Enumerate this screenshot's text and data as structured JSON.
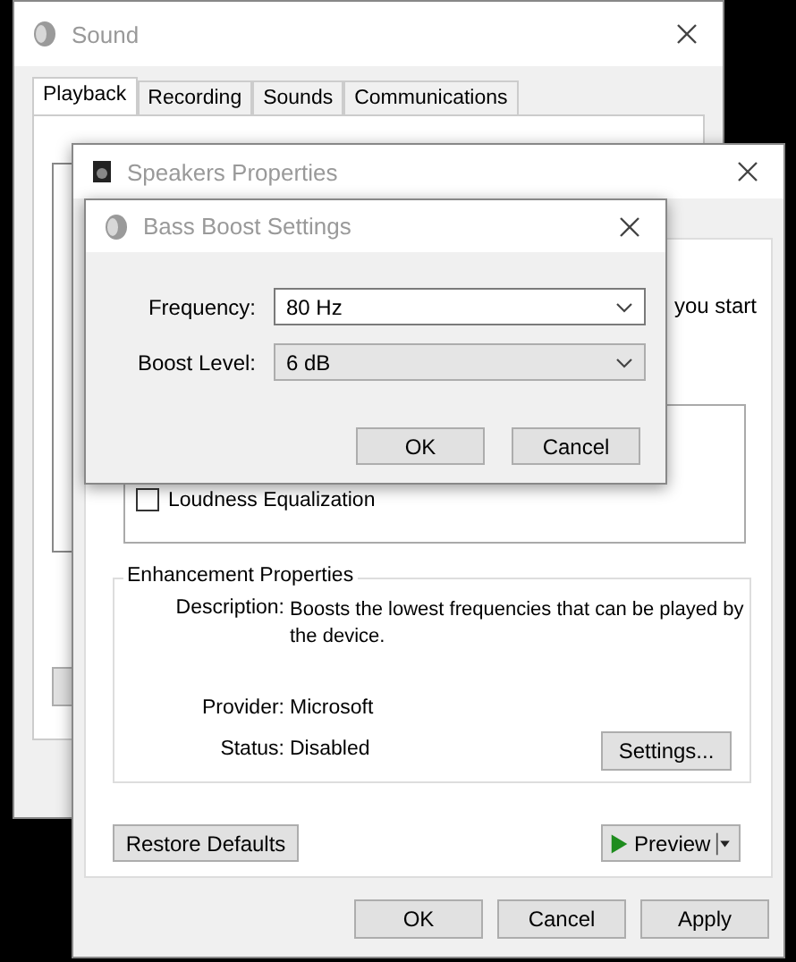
{
  "sound_window": {
    "title": "Sound",
    "tabs": [
      {
        "label": "Playback",
        "selected": true
      },
      {
        "label": "Recording",
        "selected": false
      },
      {
        "label": "Sounds",
        "selected": false
      },
      {
        "label": "Communications",
        "selected": false
      }
    ]
  },
  "speakers_window": {
    "title": "Speakers Properties",
    "partial_text": "you start",
    "enhancements": [
      {
        "label": "Loudness Equalization",
        "checked": false
      }
    ],
    "enhancement_properties": {
      "title": "Enhancement Properties",
      "description_label": "Description:",
      "description": "Boosts the lowest frequencies that can be played by the device.",
      "provider_label": "Provider:",
      "provider": "Microsoft",
      "status_label": "Status:",
      "status": "Disabled",
      "settings_button": "Settings..."
    },
    "restore_button": "Restore Defaults",
    "preview_button": "Preview",
    "buttons": [
      "OK",
      "Cancel",
      "Apply"
    ]
  },
  "bass_boost_dialog": {
    "title": "Bass Boost Settings",
    "fields": [
      {
        "label": "Frequency:",
        "value": "80 Hz",
        "disabled": false
      },
      {
        "label": "Boost Level:",
        "value": "6 dB",
        "disabled": true
      }
    ],
    "buttons": [
      "OK",
      "Cancel"
    ]
  }
}
